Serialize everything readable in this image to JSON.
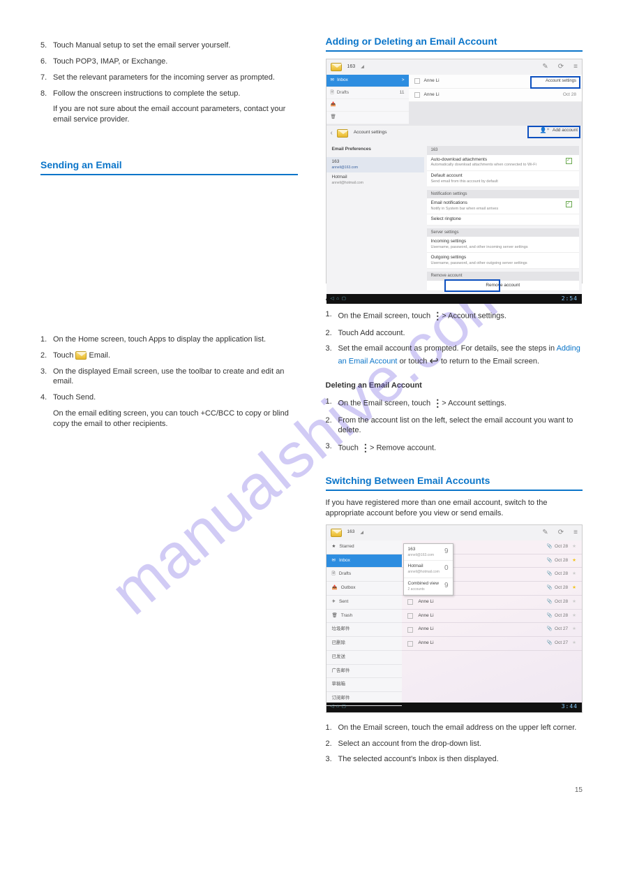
{
  "watermark": "manualshive.com",
  "left_col": {
    "intro_step5": {
      "num": "5.",
      "text": "Touch Manual setup to set the email server yourself."
    },
    "intro_step6": {
      "num": "6.",
      "text": "Touch POP3, IMAP, or Exchange."
    },
    "intro_step7_pre": {
      "num": "7.",
      "text": "Set the relevant parameters for the incoming server as prompted."
    },
    "intro_step8": {
      "num": "8.",
      "text": "Follow the onscreen instructions to complete the setup."
    },
    "tip1": "If you are not sure about the email account parameters, contact your email service provider.",
    "section1_title": "Sending an Email",
    "s1_step1": {
      "num": "1.",
      "text": "On the Home screen, touch Apps to display the application list."
    },
    "s1_step2": {
      "num": "2.",
      "pre": "Touch ",
      "post": " Email."
    },
    "s1_step3": {
      "num": "3.",
      "text": "On the displayed Email screen, use the toolbar to create and edit an email."
    },
    "s1_step4": {
      "num": "4.",
      "text": "Touch Send."
    },
    "tip2": "On the email editing screen, you can touch +CC/BCC to copy or blind copy the email to other recipients."
  },
  "right_col": {
    "section2_title": "Adding or Deleting an Email Account",
    "sub_add": "Adding an Email Account",
    "a_step1": {
      "num": "1.",
      "pre": "On the Email screen, touch ",
      "post": " > Account settings."
    },
    "a_step2": {
      "num": "2.",
      "text": "Touch Add account."
    },
    "a_step3_pre": {
      "num": "3.",
      "text": "Set the email account as prompted. For details, see the steps in"
    },
    "a_step3_link": "Adding an Email Account",
    "a_step3_post": " or touch ",
    "a_step3_post2": " to return to the Email screen.",
    "sub_del": "Deleting an Email Account",
    "d_step1": {
      "num": "1.",
      "pre": "On the Email screen, touch ",
      "post": " > Account settings."
    },
    "d_step2": {
      "num": "2.",
      "text": "From the account list on the left, select the email account you want to delete."
    },
    "d_step3": {
      "num": "3.",
      "pre": "Touch ",
      "post": " > Remove account."
    },
    "section3_title": "Switching Between Email Accounts",
    "s3_para": "If you have registered more than one email account, switch to the appropriate account before you view or send emails.",
    "s3_step1": {
      "num": "1.",
      "text": "On the Email screen, touch the email address on the upper left corner."
    },
    "s3_step2": {
      "num": "2.",
      "text": "Select an account from the drop-down list."
    },
    "s3_step3": {
      "num": "3.",
      "text": "The selected account's Inbox is then displayed."
    },
    "page_no": "15"
  },
  "shot1": {
    "acct": "163",
    "nav": {
      "inbox": "Inbox",
      "inbox_badge": ">",
      "drafts": "Drafts",
      "drafts_n": "11"
    },
    "msg1": {
      "name": "Anne Li",
      "btn": "Account settings"
    },
    "msg2": {
      "name": "Anne Li",
      "date": "Oct 28"
    },
    "inner": {
      "title": "Account settings",
      "addacct": "Add account",
      "prefs": "Email Preferences",
      "acc1": {
        "name": "163",
        "addr": "anneli@163.com"
      },
      "acc2": {
        "name": "Hotmail",
        "addr": "anneli@hotmail.com"
      },
      "detail_hdr": "163",
      "opt1": {
        "t": "Auto-download attachments",
        "s": "Automatically download attachments when connected to Wi-Fi"
      },
      "opt2": {
        "t": "Default account",
        "s": "Send email from this account by default"
      },
      "grp2": "Notification settings",
      "opt3": {
        "t": "Email notifications",
        "s": "Notify in System bar when email arrives"
      },
      "opt4": {
        "t": "Select ringtone"
      },
      "grp3": "Server settings",
      "opt5": {
        "t": "Incoming settings",
        "s": "Username, password, and other incoming server settings"
      },
      "opt6": {
        "t": "Outgoing settings",
        "s": "Username, password, and other outgoing server settings"
      },
      "grp4": "Remove account",
      "opt7": {
        "t": "Remove account"
      }
    },
    "clock": "2:54"
  },
  "shot2": {
    "acct": "163",
    "side": [
      "Starred",
      "Inbox",
      "Drafts",
      "Outbox",
      "Sent",
      "Trash",
      "垃圾邮件",
      "已删除",
      "已发送",
      "广告邮件",
      "草稿箱",
      "订阅邮件"
    ],
    "popup": [
      {
        "n": "163",
        "a": "anneli@163.com",
        "c": "9"
      },
      {
        "n": "Hotmail",
        "a": "anneli@hotmail.com",
        "c": "0"
      },
      {
        "n": "Combined view",
        "a": "2 accounts",
        "c": "9"
      }
    ],
    "rows": [
      {
        "n": "Anne Li",
        "d": "Oct 28",
        "s": false
      },
      {
        "n": "Anne Li",
        "d": "Oct 28",
        "s": true
      },
      {
        "n": "Anne Li",
        "d": "Oct 28",
        "s": false
      },
      {
        "n": "Anne Li",
        "d": "Oct 28",
        "s": true
      },
      {
        "n": "Anne Li",
        "d": "Oct 28",
        "s": false
      },
      {
        "n": "Anne Li",
        "d": "Oct 28",
        "s": false
      },
      {
        "n": "Anne Li",
        "d": "Oct 27",
        "s": false
      },
      {
        "n": "Anne Li",
        "d": "Oct 27",
        "s": false
      }
    ],
    "clock": "3:44"
  }
}
